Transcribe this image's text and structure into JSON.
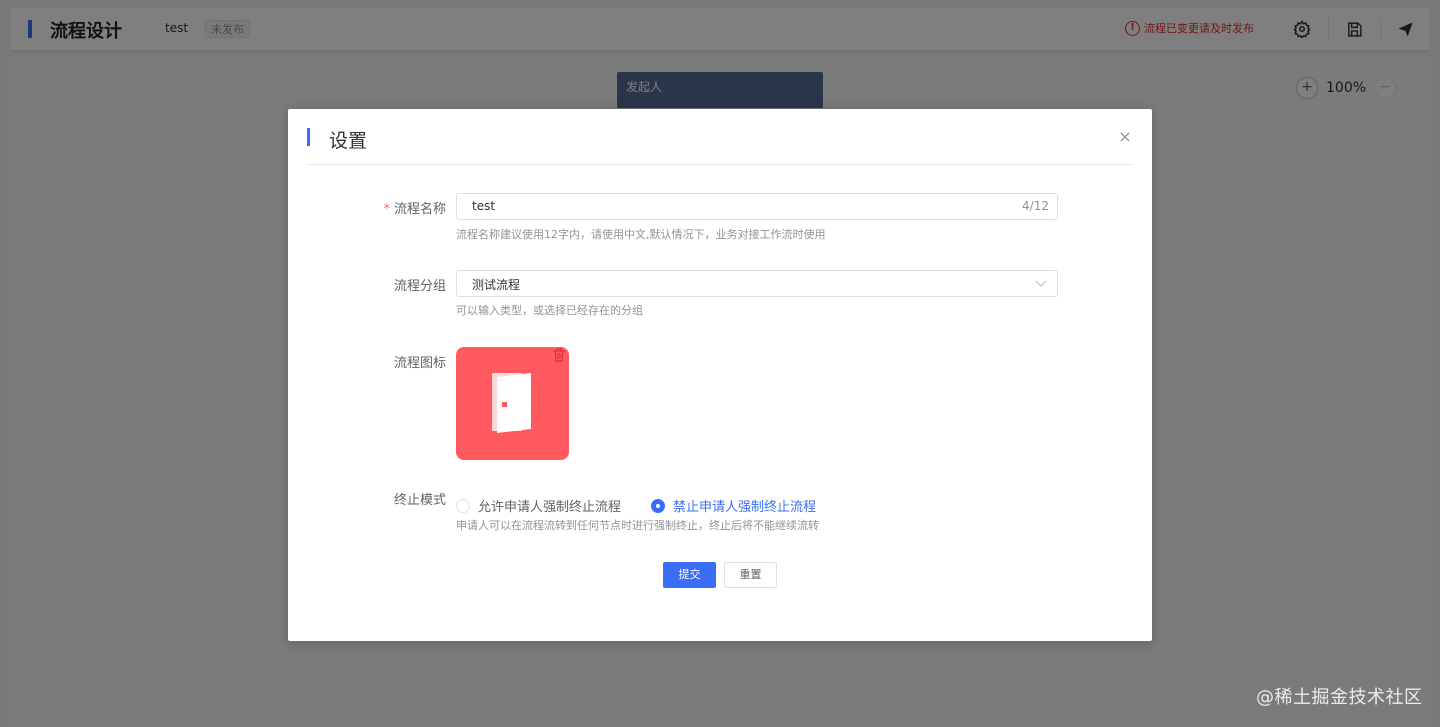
{
  "header": {
    "title": "流程设计",
    "process_name": "test",
    "status": "未发布",
    "warning": "流程已变更请及时发布",
    "icons": [
      "settings-icon",
      "save-icon",
      "publish-icon"
    ]
  },
  "canvas": {
    "zoom": "100%",
    "zoom_in": "+",
    "zoom_out": "−",
    "start_node": "发起人"
  },
  "dialog": {
    "title": "设置",
    "close": "×",
    "fields": {
      "name": {
        "required_mark": "*",
        "label": "流程名称",
        "value": "test",
        "count": "4/12",
        "hint": "流程名称建议使用12字内，请使用中文,默认情况下，业务对接工作流时使用"
      },
      "group": {
        "label": "流程分组",
        "value": "测试流程",
        "hint": "可以输入类型，或选择已经存在的分组"
      },
      "icon": {
        "label": "流程图标",
        "icon_name": "door-icon",
        "background": "#ff5a5f"
      },
      "end_mode": {
        "label": "终止模式",
        "options": [
          "允许申请人强制终止流程",
          "禁止申请人强制终止流程"
        ],
        "selected": "禁止申请人强制终止流程",
        "hint": "申请人可以在流程流转到任何节点时进行强制终止，终止后将不能继续流转"
      }
    },
    "buttons": {
      "submit": "提交",
      "reset": "重置"
    }
  },
  "watermark": "@稀土掘金技术社区",
  "colors": {
    "accent": "#3a6ef6",
    "warning": "#e03131",
    "icon_bg": "#ff5a5f"
  }
}
